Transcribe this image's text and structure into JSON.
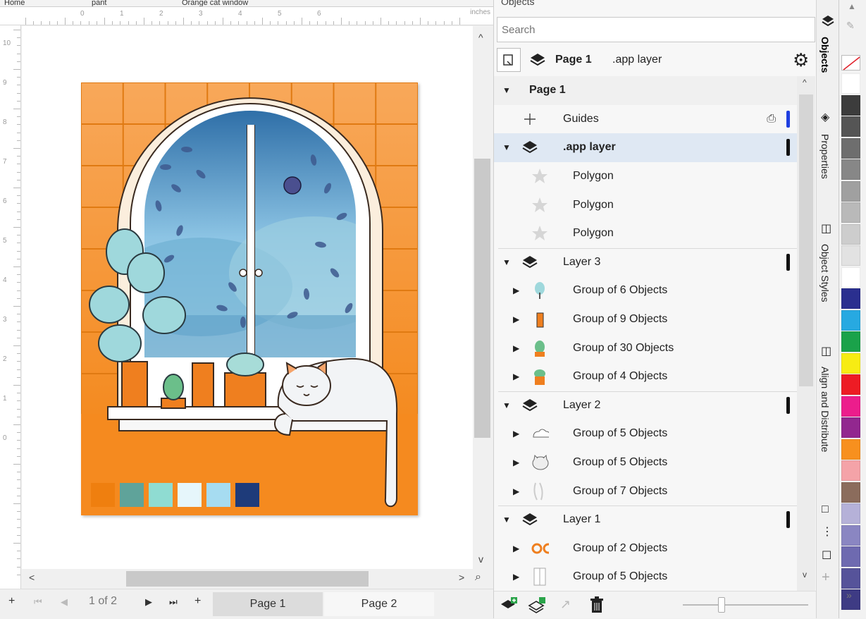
{
  "document_tabs": [
    "Home",
    "pant",
    "Orange cat window"
  ],
  "ruler": {
    "units": "inches",
    "h_labels": [
      "0",
      "1",
      "2",
      "3",
      "4",
      "5",
      "6"
    ],
    "v_labels": [
      "10",
      "9",
      "8",
      "7",
      "6",
      "5",
      "4",
      "3",
      "2",
      "1",
      "0"
    ]
  },
  "page_nav": {
    "add_left": "+",
    "first": "⏮",
    "prev": "◀",
    "page_counter": "1 of 2",
    "next": "▶",
    "last": "⏭",
    "add_right": "+",
    "tabs": [
      "Page 1",
      "Page 2"
    ]
  },
  "docker": {
    "title": "Objects",
    "search_placeholder": "Search",
    "current_page": "Page 1",
    "current_layer": ".app layer",
    "tree": [
      {
        "label": "Page 1",
        "type": "page",
        "indent": 0,
        "expanded": true
      },
      {
        "label": "Guides",
        "type": "guides",
        "indent": 1
      },
      {
        "label": ".app layer",
        "type": "layer",
        "indent": 0,
        "expanded": true,
        "selected": true
      },
      {
        "label": "Polygon",
        "type": "polygon",
        "indent": 2
      },
      {
        "label": "Polygon",
        "type": "polygon",
        "indent": 2
      },
      {
        "label": "Polygon",
        "type": "polygon",
        "indent": 2
      },
      {
        "label": "Layer 3",
        "type": "layer",
        "indent": 0,
        "expanded": true
      },
      {
        "label": "Group of 6 Objects",
        "type": "group",
        "indent": 1,
        "thumb": "tree"
      },
      {
        "label": "Group of 9 Objects",
        "type": "group",
        "indent": 1,
        "thumb": "pot"
      },
      {
        "label": "Group of 30 Objects",
        "type": "group",
        "indent": 1,
        "thumb": "cactus"
      },
      {
        "label": "Group of 4 Objects",
        "type": "group",
        "indent": 1,
        "thumb": "succulent"
      },
      {
        "label": "Layer 2",
        "type": "layer",
        "indent": 0,
        "expanded": true
      },
      {
        "label": "Group of 5 Objects",
        "type": "group",
        "indent": 1,
        "thumb": "cloud"
      },
      {
        "label": "Group of 5 Objects",
        "type": "group",
        "indent": 1,
        "thumb": "cat"
      },
      {
        "label": "Group of 7 Objects",
        "type": "group",
        "indent": 1,
        "thumb": "curtain"
      },
      {
        "label": "Layer 1",
        "type": "layer",
        "indent": 0,
        "expanded": true
      },
      {
        "label": "Group of 2 Objects",
        "type": "group",
        "indent": 1,
        "thumb": "rings"
      },
      {
        "label": "Group of 5 Objects",
        "type": "group",
        "indent": 1,
        "thumb": "frame"
      }
    ]
  },
  "side_tabs": [
    "Objects",
    "Properties",
    "Object Styles",
    "Align and Distribute"
  ],
  "palette": [
    "#ffffff",
    "#3c3c3c",
    "#555555",
    "#6e6e6e",
    "#878787",
    "#a0a0a0",
    "#b9b9b9",
    "#cdcdcd",
    "#e2e2e2",
    "#ffffff",
    "#2a2f8f",
    "#27a9e1",
    "#1aa24a",
    "#f7ec13",
    "#ed1c24",
    "#ec1d8c",
    "#92278f",
    "#f7901e",
    "#f4a3a8",
    "#8b6c5c",
    "#b5b1d8",
    "#8a86c2",
    "#6e6ab0",
    "#56539a",
    "#3e3b84"
  ],
  "artwork_colors": {
    "wall": "#f58a1f",
    "tile": "#f8a64a",
    "sky": "#8fc6e6",
    "swatches": [
      "#ef7f0f",
      "#5fa39a",
      "#8fdcd2",
      "#e6f6fb",
      "#a6dcf1",
      "#1e3b7a"
    ]
  }
}
